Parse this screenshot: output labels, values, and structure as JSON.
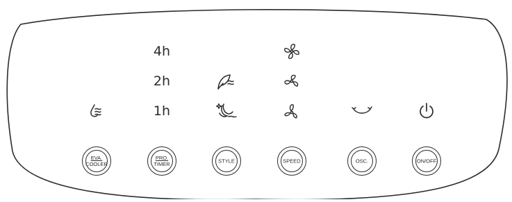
{
  "timer": {
    "opt_4h": "4h",
    "opt_2h": "2h",
    "opt_1h": "1h"
  },
  "icons": {
    "cooler": "water-drop-waves-icon",
    "style_natural": "leaf-wind-icon",
    "style_sleep": "moon-star-icon",
    "speed_high": "fan-high-icon",
    "speed_mid": "fan-mid-icon",
    "speed_low": "fan-low-icon",
    "oscillation": "oscillation-icon",
    "power": "power-icon"
  },
  "buttons": {
    "eva_cooler": {
      "line1": "EVA.",
      "line2": "COOLER"
    },
    "pro_timer": {
      "line1": "PRO.",
      "line2": "TIMER"
    },
    "style": "STYLE",
    "speed": "SPEED",
    "osc": "OSC.",
    "onoff": "ON/OFF"
  },
  "colors": {
    "ink": "#2b2b2b",
    "background": "#ffffff"
  }
}
